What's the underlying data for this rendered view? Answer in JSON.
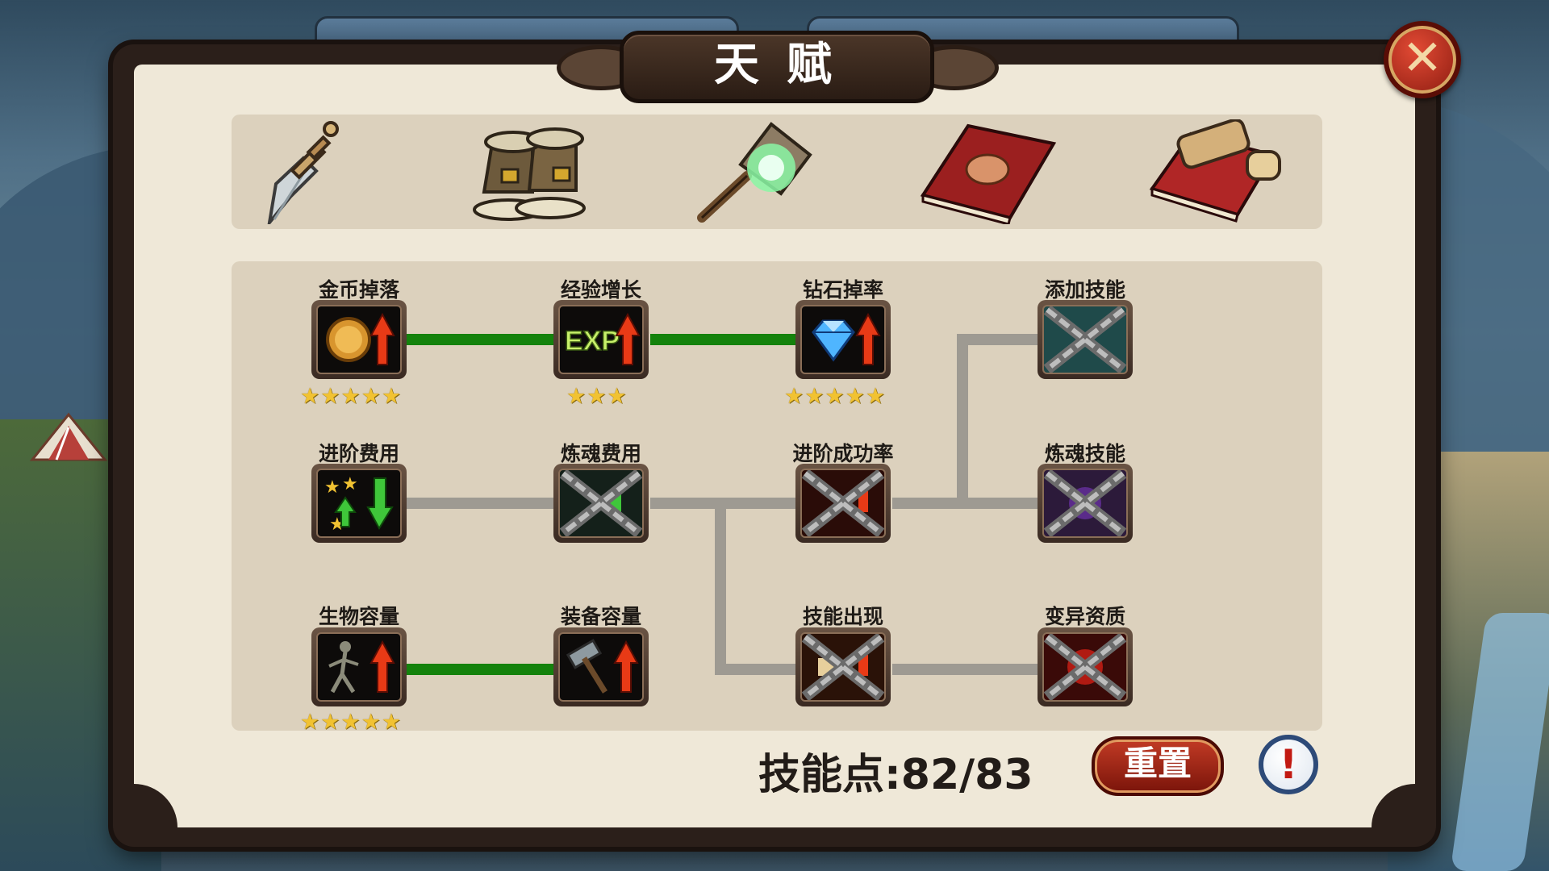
{
  "window": {
    "title": "天赋"
  },
  "top_bars": {
    "left_value": "",
    "right_value": ""
  },
  "tabs": [
    {
      "name": "sword",
      "icon": "sword-icon"
    },
    {
      "name": "boots",
      "icon": "boots-icon"
    },
    {
      "name": "torch",
      "icon": "magic-torch-icon"
    },
    {
      "name": "strength-book",
      "icon": "strength-book-icon"
    },
    {
      "name": "scroll-book",
      "icon": "scroll-book-icon"
    }
  ],
  "talents": [
    {
      "id": "gold-drop",
      "label": "金币掉落",
      "icon": "gold-coin-up-icon",
      "unlocked": true,
      "stars": 5
    },
    {
      "id": "exp-growth",
      "label": "经验增长",
      "icon": "exp-up-icon",
      "icon_text": "EXP",
      "unlocked": true,
      "stars": 3
    },
    {
      "id": "diamond-rate",
      "label": "钻石掉率",
      "icon": "diamond-up-icon",
      "unlocked": true,
      "stars": 5
    },
    {
      "id": "add-skill",
      "label": "添加技能",
      "icon": "add-skill-icon",
      "unlocked": false,
      "stars": 0
    },
    {
      "id": "advance-cost",
      "label": "进阶费用",
      "icon": "advance-cost-icon",
      "unlocked": true,
      "stars": 0
    },
    {
      "id": "refine-cost",
      "label": "炼魂费用",
      "icon": "refine-cost-icon",
      "unlocked": false,
      "stars": 0
    },
    {
      "id": "advance-success",
      "label": "进阶成功率",
      "icon": "advance-success-icon",
      "unlocked": false,
      "stars": 0
    },
    {
      "id": "refine-skill",
      "label": "炼魂技能",
      "icon": "refine-skill-icon",
      "unlocked": false,
      "stars": 0
    },
    {
      "id": "creature-capacity",
      "label": "生物容量",
      "icon": "creature-capacity-icon",
      "unlocked": true,
      "stars": 5
    },
    {
      "id": "equip-capacity",
      "label": "装备容量",
      "icon": "equip-capacity-icon",
      "unlocked": true,
      "stars": 0
    },
    {
      "id": "skill-appear",
      "label": "技能出现",
      "icon": "skill-appear-icon",
      "unlocked": false,
      "stars": 0
    },
    {
      "id": "mutation",
      "label": "变异资质",
      "icon": "mutation-icon",
      "unlocked": false,
      "stars": 0
    }
  ],
  "footer": {
    "points_text": "技能点:82/83",
    "reset_label": "重置",
    "info_symbol": "!"
  },
  "colors": {
    "active_path": "#14820c",
    "inactive_path": "#9e9a92",
    "panel_bg": "#efe8d8",
    "star": "#f1c232"
  }
}
